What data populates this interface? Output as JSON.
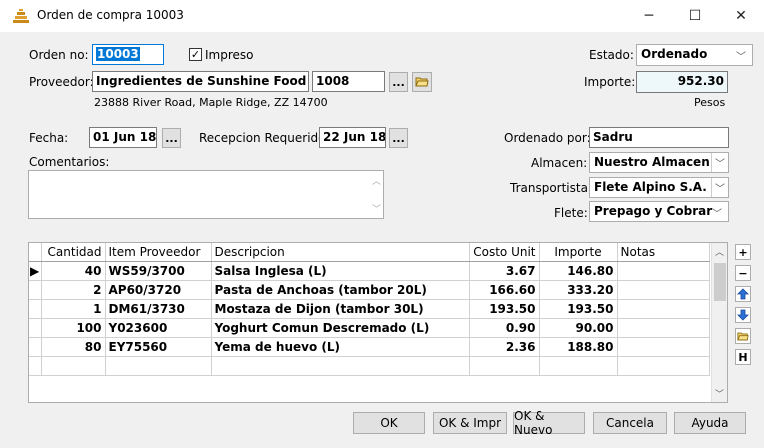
{
  "window": {
    "title": "Orden de compra 10003",
    "controls": {
      "minimize": "─",
      "maximize": "☐",
      "close": "✕"
    }
  },
  "order": {
    "number_label": "Orden no:",
    "number": "10003",
    "printed_label": "Impreso",
    "printed": true
  },
  "supplier": {
    "label": "Proveedor:",
    "name": "Ingredientes de Sunshine Food Ltda.",
    "code": "1008",
    "browse": "...",
    "address": "23888 River Road, Maple Ridge, ZZ  14700"
  },
  "status": {
    "label": "Estado:",
    "value": "Ordenado"
  },
  "amount": {
    "label": "Importe:",
    "value": "952.30",
    "currency": "Pesos"
  },
  "dates": {
    "date_label": "Fecha:",
    "date": "01 Jun 18",
    "required_label": "Recepcion Requerido:",
    "required": "22 Jun 18",
    "browse": "..."
  },
  "comments": {
    "label": "Comentarios:",
    "value": ""
  },
  "right_fields": {
    "ordered_by_label": "Ordenado por:",
    "ordered_by": "Sadru",
    "warehouse_label": "Almacen:",
    "warehouse": "Nuestro Almacen",
    "carrier_label": "Transportista:",
    "carrier": "Flete Alpino S.A.",
    "freight_label": "Flete:",
    "freight": "Prepago y Cobrar"
  },
  "grid": {
    "columns": [
      "Cantidad",
      "Item Proveedor",
      "Descripcion",
      "Costo Unit",
      "Importe",
      "Notas"
    ],
    "rows": [
      {
        "qty": "40",
        "item": "WS59/3700",
        "desc": "Salsa Inglesa (L)",
        "cost": "3.67",
        "amount": "146.80",
        "notes": ""
      },
      {
        "qty": "2",
        "item": "AP60/3720",
        "desc": "Pasta de Anchoas (tambor 20L)",
        "cost": "166.60",
        "amount": "333.20",
        "notes": ""
      },
      {
        "qty": "1",
        "item": "DM61/3730",
        "desc": "Mostaza de Dijon (tambor 30L)",
        "cost": "193.50",
        "amount": "193.50",
        "notes": ""
      },
      {
        "qty": "100",
        "item": "Y023600",
        "desc": "Yoghurt Comun Descremado (L)",
        "cost": "0.90",
        "amount": "90.00",
        "notes": ""
      },
      {
        "qty": "80",
        "item": "EY75560",
        "desc": "Yema de huevo (L)",
        "cost": "2.36",
        "amount": "188.80",
        "notes": ""
      }
    ],
    "side_buttons": {
      "add": "+",
      "remove": "−",
      "up": "🡅",
      "down": "🡇",
      "open": "📂",
      "history": "H"
    }
  },
  "buttons": {
    "ok": "OK",
    "ok_print": "OK & Impr",
    "ok_new": "OK & Nuevo",
    "cancel": "Cancela",
    "help": "Ayuda"
  },
  "colors": {
    "accent": "#0078d7",
    "amount_bg": "#eef8fb"
  }
}
